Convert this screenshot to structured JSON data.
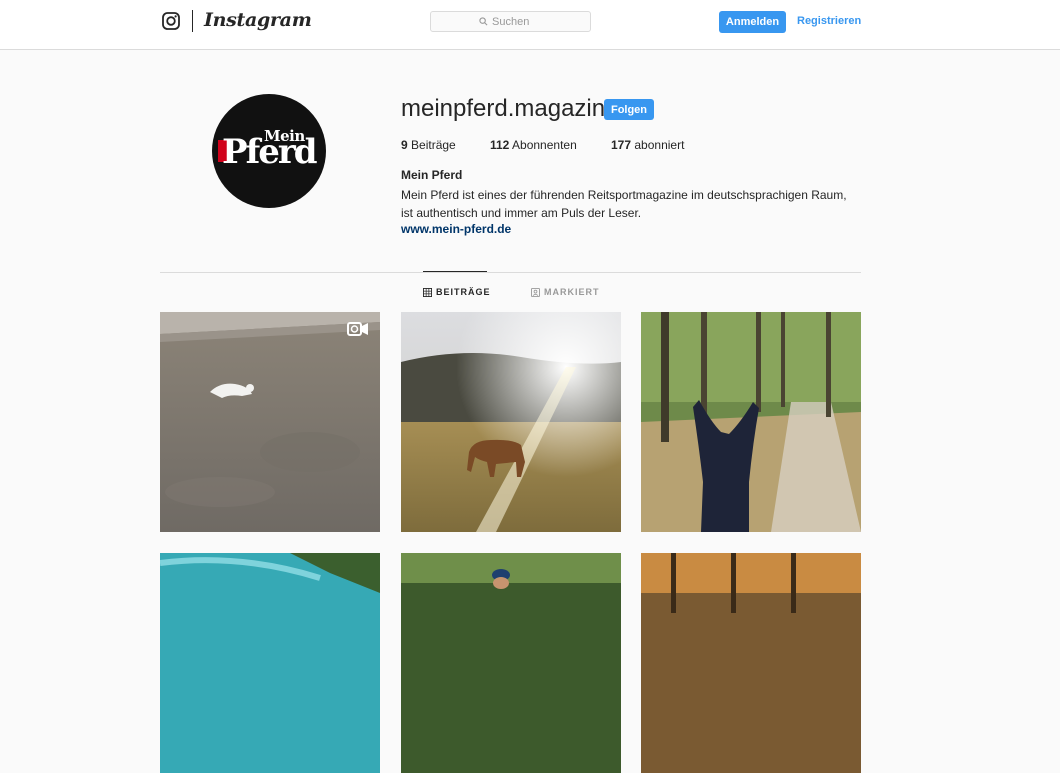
{
  "nav": {
    "brand": "Instagram",
    "search_placeholder": "Suchen",
    "login_label": "Anmelden",
    "register_label": "Registrieren"
  },
  "profile": {
    "avatar_logo": "Mein Pferd",
    "username": "meinpferd.magazin",
    "follow_label": "Folgen",
    "stats": {
      "posts_count": "9",
      "posts_label": "Beiträge",
      "followers_count": "112",
      "followers_label": "Abonnenten",
      "following_count": "177",
      "following_label": "abonniert"
    },
    "full_name": "Mein Pferd",
    "bio": "Mein Pferd ist eines der führenden Reitsportmagazine im deutschsprachigen Raum, ist authentisch und immer am Puls der Leser.",
    "website": "www.mein-pferd.de"
  },
  "tabs": [
    {
      "label": "BEITRÄGE",
      "active": true,
      "icon": "grid-icon"
    },
    {
      "label": "MARKIERT",
      "active": false,
      "icon": "tag-portrait-icon"
    }
  ],
  "posts": [
    {
      "subject": "white dog running in riding arena",
      "icon": "video-icon"
    },
    {
      "subject": "horse grazing on meadow in sunlight"
    },
    {
      "subject": "view between horse ears on autumn forest path"
    },
    {
      "subject": "turquoise water"
    },
    {
      "subject": "rider in blue cap among trees"
    },
    {
      "subject": "autumn forest"
    }
  ],
  "colors": {
    "accent": "#3897f0",
    "link": "#003569",
    "text": "#262626",
    "border": "#dbdbdb",
    "background": "#fafafa"
  }
}
